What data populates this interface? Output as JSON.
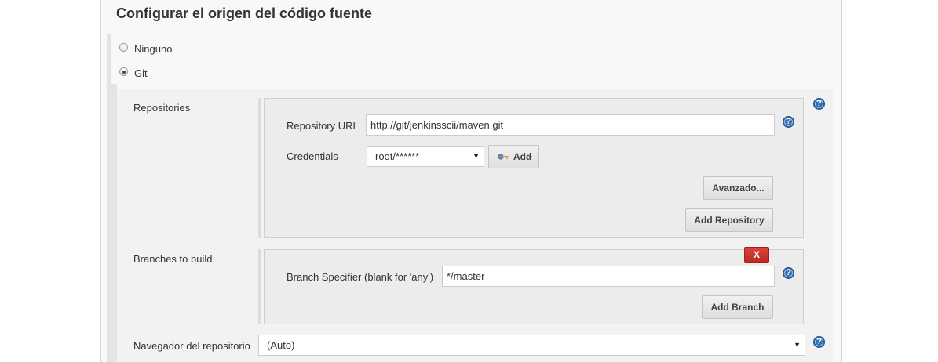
{
  "section": {
    "title": "Configurar el origen del código fuente"
  },
  "scm_options": [
    {
      "label": "Ninguno",
      "selected": false
    },
    {
      "label": "Git",
      "selected": true
    }
  ],
  "git": {
    "repositories_label": "Repositories",
    "repository": {
      "url_label": "Repository URL",
      "url_value": "http://git/jenkinsscii/maven.git",
      "credentials_label": "Credentials",
      "credentials_value": "root/******",
      "add_credentials_label": "Add",
      "advanced_label": "Avanzado...",
      "add_repository_label": "Add Repository"
    },
    "branches_label": "Branches to build",
    "branch": {
      "delete_label": "X",
      "specifier_label": "Branch Specifier (blank for 'any')",
      "specifier_value": "*/master",
      "add_branch_label": "Add Branch"
    },
    "browser_label": "Navegador del repositorio",
    "browser_value": "(Auto)"
  },
  "icons": {
    "help": "help-icon",
    "key": "key-icon",
    "dropdown": "dropdown-arrow-icon"
  },
  "colors": {
    "help_icon": "#2f6eb1",
    "delete_button": "#c9332d"
  }
}
